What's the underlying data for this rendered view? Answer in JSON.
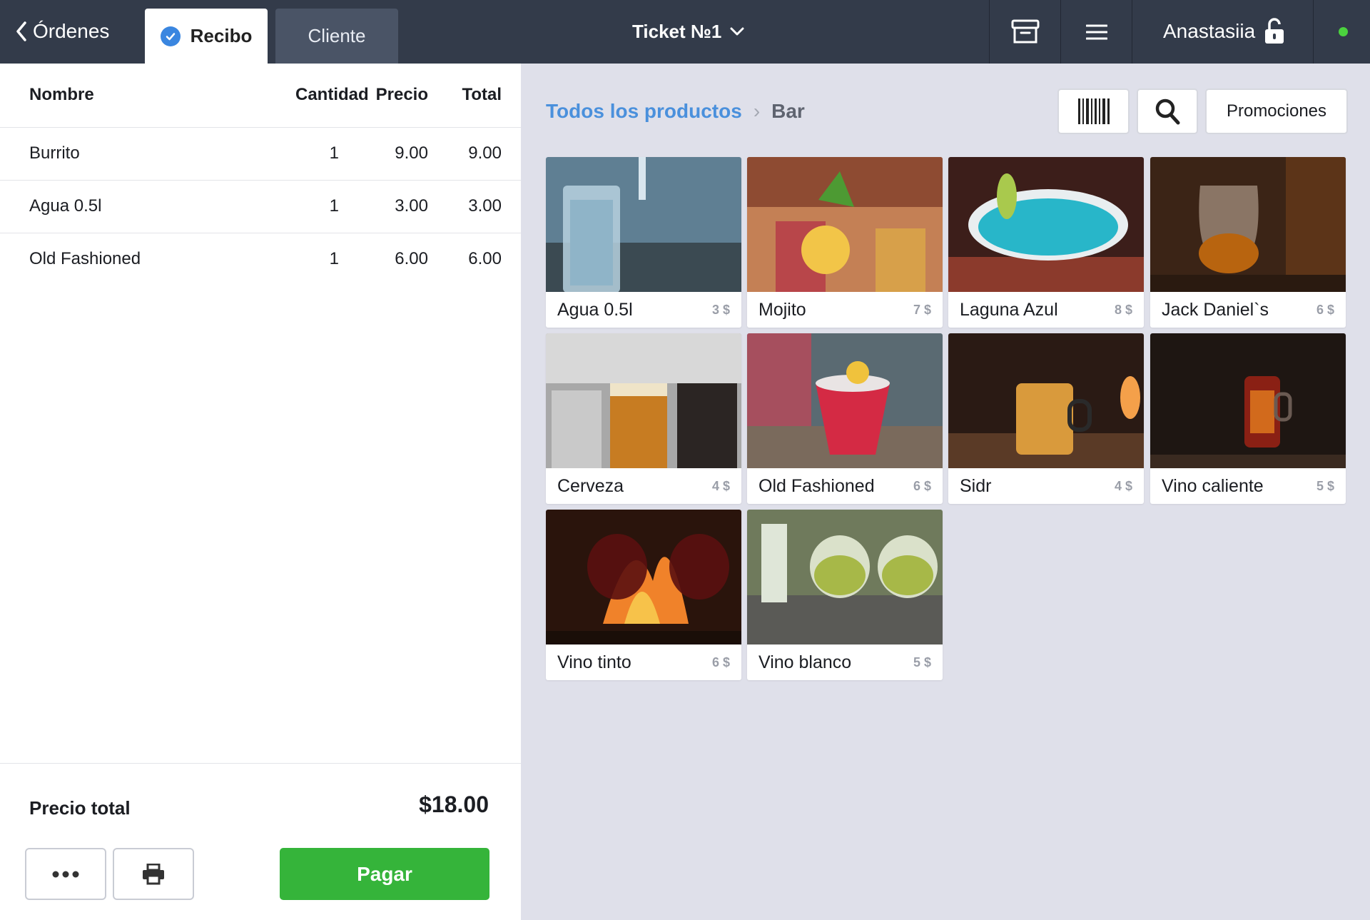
{
  "topbar": {
    "back_label": "Órdenes",
    "tabs": [
      {
        "label": "Recibo",
        "active": true
      },
      {
        "label": "Cliente",
        "active": false
      }
    ],
    "ticket_label": "Ticket №1",
    "user_name": "Anastasiia",
    "status_color": "#4bd23e",
    "icons": [
      "archive-icon",
      "menu-icon",
      "unlock-icon"
    ]
  },
  "receipt": {
    "columns": {
      "name": "Nombre",
      "qty": "Cantidad",
      "price": "Precio",
      "total": "Total"
    },
    "items": [
      {
        "name": "Burrito",
        "qty": "1",
        "price": "9.00",
        "total": "9.00"
      },
      {
        "name": "Agua 0.5l",
        "qty": "1",
        "price": "3.00",
        "total": "3.00"
      },
      {
        "name": "Old Fashioned",
        "qty": "1",
        "price": "6.00",
        "total": "6.00"
      }
    ],
    "total_label": "Precio total",
    "total_value": "$18.00",
    "more_icon": "more-dots-icon",
    "print_icon": "printer-icon",
    "pay_label": "Pagar",
    "pay_color": "#35b43a"
  },
  "catalog": {
    "breadcrumb_root": "Todos los productos",
    "breadcrumb_current": "Bar",
    "barcode_icon": "barcode-icon",
    "search_icon": "search-icon",
    "promotions_label": "Promociones",
    "products": [
      {
        "name": "Agua 0.5l",
        "price": "3 $"
      },
      {
        "name": "Mojito",
        "price": "7 $"
      },
      {
        "name": "Laguna Azul",
        "price": "8 $"
      },
      {
        "name": "Jack Daniel`s",
        "price": "6 $"
      },
      {
        "name": "Cerveza",
        "price": "4 $"
      },
      {
        "name": "Old Fashioned",
        "price": "6 $"
      },
      {
        "name": "Sidr",
        "price": "4 $"
      },
      {
        "name": "Vino caliente",
        "price": "5 $"
      },
      {
        "name": "Vino tinto",
        "price": "6 $"
      },
      {
        "name": "Vino blanco",
        "price": "5 $"
      }
    ]
  }
}
